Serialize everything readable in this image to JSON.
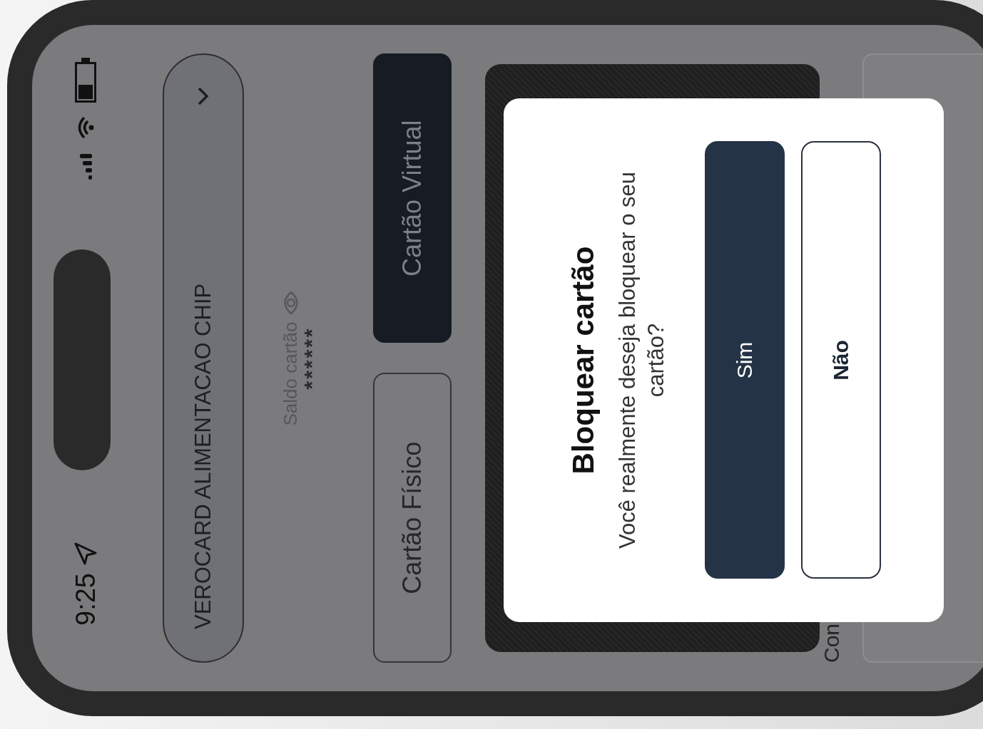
{
  "status_bar": {
    "time": "9:25"
  },
  "card_selector": {
    "label": "VEROCARD ALIMENTACAO CHIP"
  },
  "balance": {
    "label": "Saldo cartão",
    "value": "******"
  },
  "tabs": [
    {
      "label": "Cartão Físico",
      "selected": false
    },
    {
      "label": "Cartão Virtual",
      "selected": true
    }
  ],
  "section_label": "Con",
  "dialog": {
    "title": "Bloquear cartão",
    "message": "Você realmente deseja bloquear o seu cartão?",
    "buttons": [
      {
        "label": "Sim",
        "kind": "primary"
      },
      {
        "label": "Não",
        "kind": "secondary"
      }
    ]
  }
}
